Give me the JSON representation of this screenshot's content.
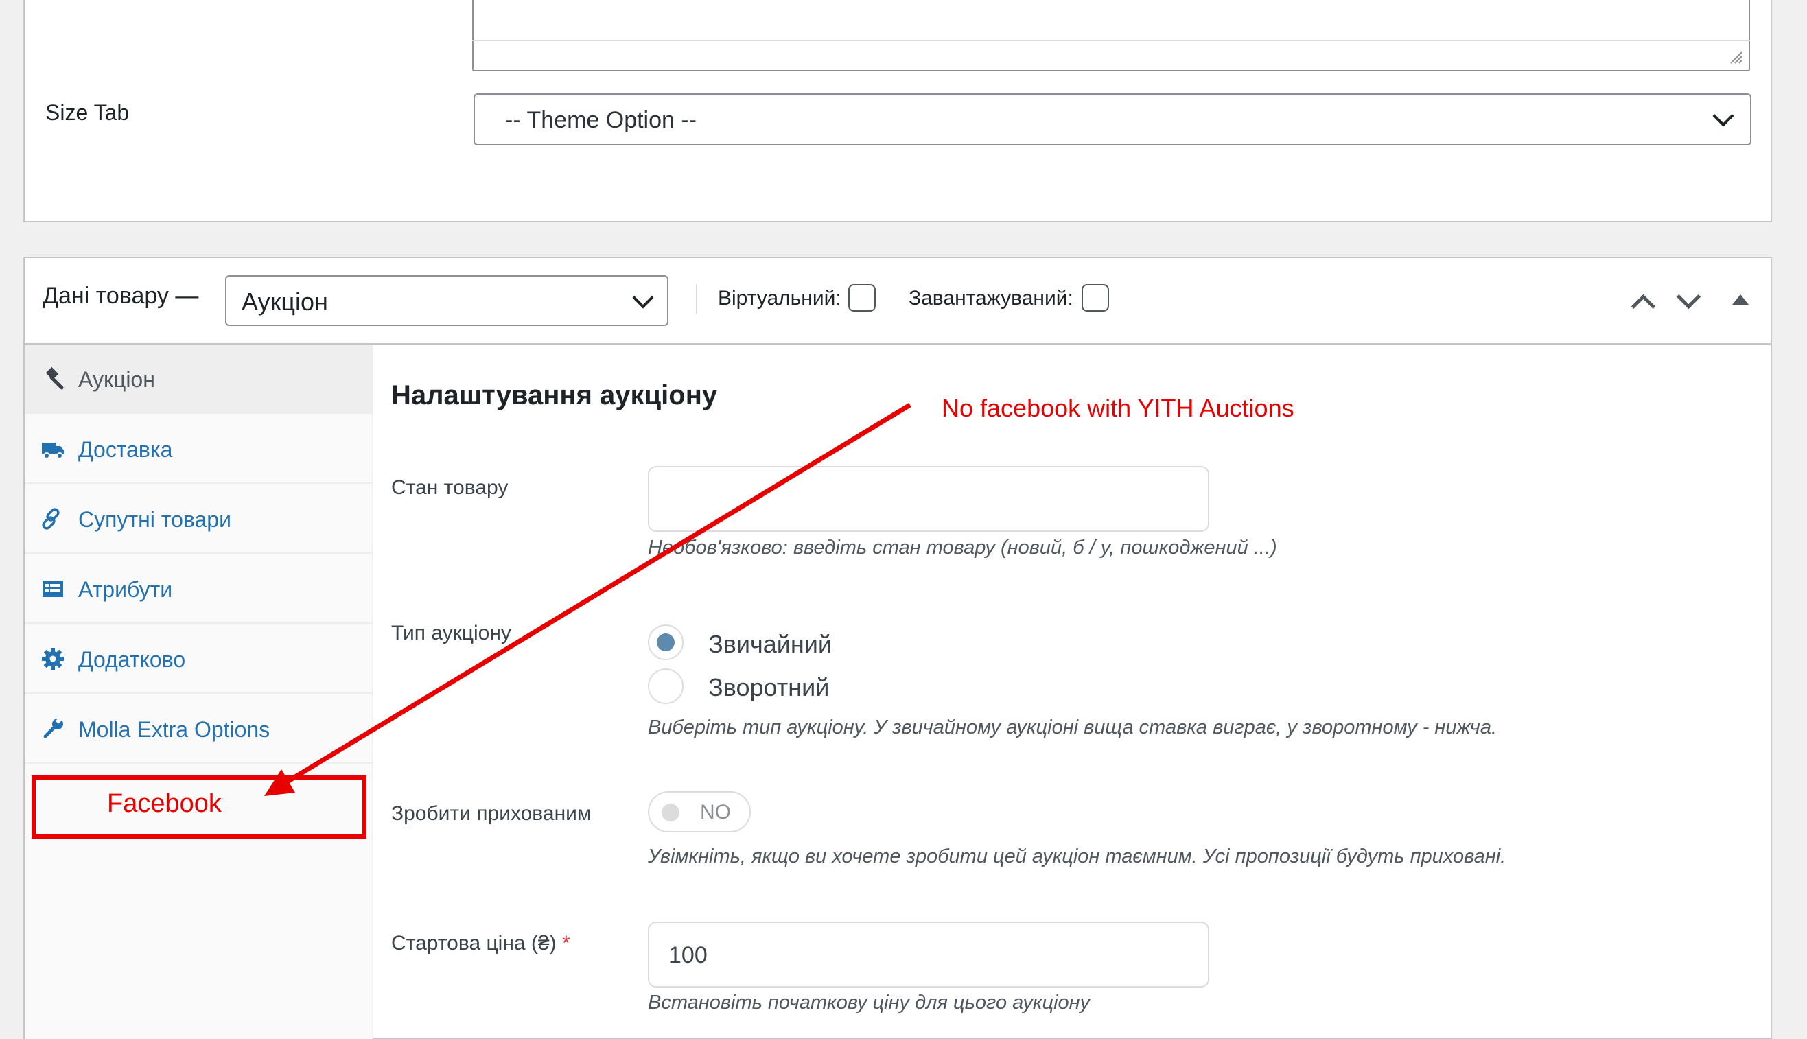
{
  "top_panel": {
    "size_tab_label": "Size Tab",
    "size_tab_value": "-- Theme Option --"
  },
  "product_data": {
    "title": "Дані товару —",
    "type_value": "Аукціон",
    "virtual_label": "Віртуальний:",
    "downloadable_label": "Завантажуваний:"
  },
  "tabs": [
    {
      "label": "Аукціон",
      "icon": "gavel-icon",
      "active": true
    },
    {
      "label": "Доставка",
      "icon": "truck-icon",
      "active": false
    },
    {
      "label": "Супутні товари",
      "icon": "link-icon",
      "active": false
    },
    {
      "label": "Атрибути",
      "icon": "list-icon",
      "active": false
    },
    {
      "label": "Додатково",
      "icon": "gear-icon",
      "active": false
    },
    {
      "label": "Molla Extra Options",
      "icon": "wrench-icon",
      "active": false
    }
  ],
  "auction_settings": {
    "title": "Налаштування аукціону",
    "condition": {
      "label": "Стан товару",
      "value": "",
      "description": "Необов'язково: введіть стан товару (новий, б / у, пошкоджений ...)"
    },
    "auction_type": {
      "label": "Тип аукціону",
      "options": [
        "Звичайний",
        "Зворотний"
      ],
      "selected": "Звичайний",
      "description": "Виберіть тип аукціону. У звичайному аукціоні вища ставка виграє, у зворотному - нижча."
    },
    "hidden": {
      "label": "Зробити прихованим",
      "toggle_text": "NO",
      "description": "Увімкніть, якщо ви хочете зробити цей аукціон таємним. Усі пропозиції будуть приховані."
    },
    "start_price": {
      "label": "Стартова ціна (₴)",
      "required_mark": "*",
      "value": "100",
      "description": "Встановіть початкову ціну для цього аукціону"
    }
  },
  "annotation": {
    "note": "No facebook with YITH Auctions",
    "box_label": "Facebook",
    "color": "#e60000"
  },
  "colors": {
    "link": "#2271b1",
    "radio_checked": "#5e8bad"
  }
}
